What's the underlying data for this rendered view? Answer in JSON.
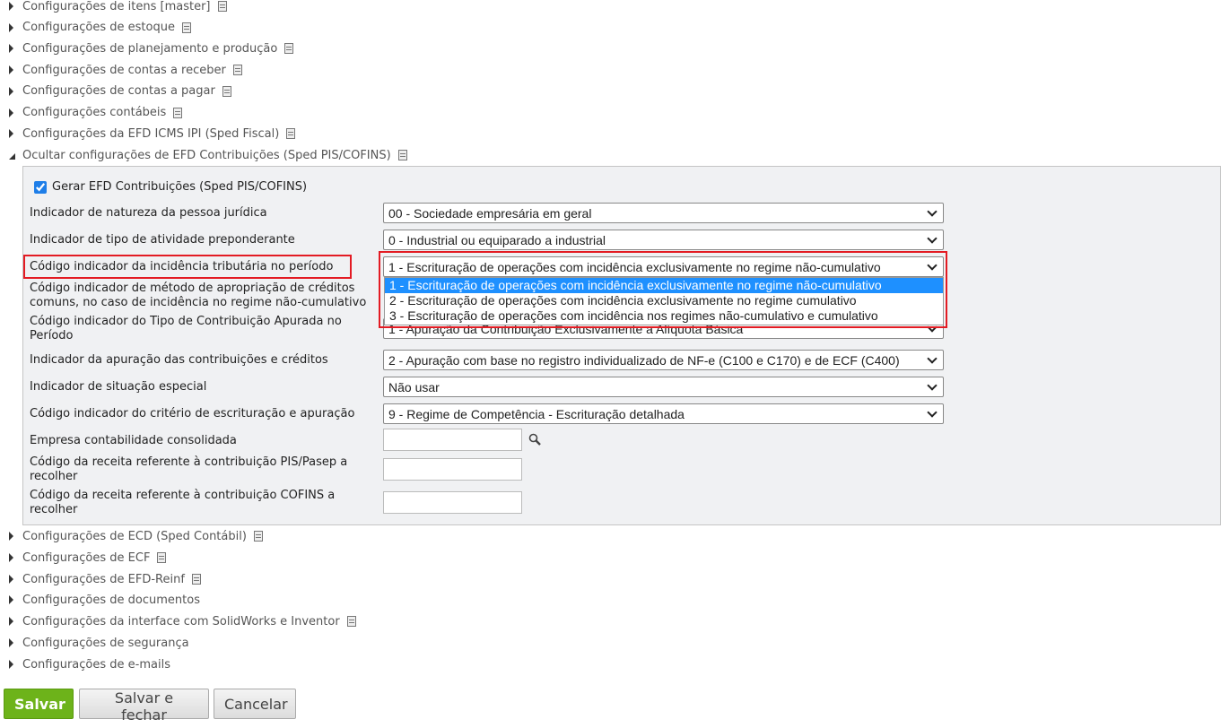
{
  "sections_top": [
    "Configurações de itens [master]",
    "Configurações de estoque",
    "Configurações de planejamento e produção",
    "Configurações de contas a receber",
    "Configurações de contas a pagar",
    "Configurações contábeis",
    "Configurações da EFD ICMS IPI (Sped Fiscal)"
  ],
  "open_section": {
    "label": "Ocultar configurações de EFD Contribuições (Sped PIS/COFINS)",
    "checkbox": {
      "label": "Gerar EFD Contribuições (Sped PIS/COFINS)",
      "checked": true
    },
    "fields": [
      {
        "label": "Indicador de natureza da pessoa jurídica",
        "value": "00 - Sociedade empresária em geral"
      },
      {
        "label": "Indicador de tipo de atividade preponderante",
        "value": "0 - Industrial ou equiparado a industrial"
      },
      {
        "label": "Código indicador da incidência tributária no período",
        "value": "1 - Escrituração de operações com incidência exclusivamente no regime não-cumulativo"
      },
      {
        "label": "Código indicador de método de apropriação de créditos comuns, no caso de incidência no regime não-cumulativo",
        "value": ""
      },
      {
        "label": "Código indicador do Tipo de Contribuição Apurada no Período",
        "value": "1 - Apuração da Contribuição Exclusivamente a Alíquota Básica"
      },
      {
        "label": "Indicador da apuração das contribuições e créditos",
        "value": "2 - Apuração com base no registro individualizado de NF-e (C100 e C170) e de ECF (C400)"
      },
      {
        "label": "Indicador de situação especial",
        "value": "Não usar"
      },
      {
        "label": "Código indicador do critério de escrituração e apuração",
        "value": "9 - Regime de Competência - Escrituração detalhada"
      }
    ],
    "inputs": [
      {
        "label": "Empresa contabilidade consolidada",
        "value": ""
      },
      {
        "label": "Código da receita referente à contribuição PIS/Pasep a recolher",
        "value": ""
      },
      {
        "label": "Código da receita referente à contribuição COFINS a recolher",
        "value": ""
      }
    ],
    "dropdown_options": [
      "1 - Escrituração de operações com incidência exclusivamente no regime não-cumulativo",
      "2 - Escrituração de operações com incidência exclusivamente no regime cumulativo",
      "3 - Escrituração de operações com incidência nos regimes não-cumulativo e cumulativo"
    ],
    "dropdown_selected_index": 0
  },
  "sections_bottom": [
    {
      "label": "Configurações de ECD (Sped Contábil)",
      "doc": true
    },
    {
      "label": "Configurações de ECF",
      "doc": true
    },
    {
      "label": "Configurações de EFD-Reinf",
      "doc": true
    },
    {
      "label": "Configurações de documentos",
      "doc": false
    },
    {
      "label": "Configurações da interface com SolidWorks e Inventor",
      "doc": true
    },
    {
      "label": "Configurações de segurança",
      "doc": false
    },
    {
      "label": "Configurações de e-mails",
      "doc": false
    }
  ],
  "buttons": {
    "save": "Salvar",
    "save_close": "Salvar e fechar",
    "cancel": "Cancelar"
  },
  "colors": {
    "primary_button": "#6db31a",
    "highlight": "#e31b23",
    "option_selected": "#1e90ff"
  }
}
